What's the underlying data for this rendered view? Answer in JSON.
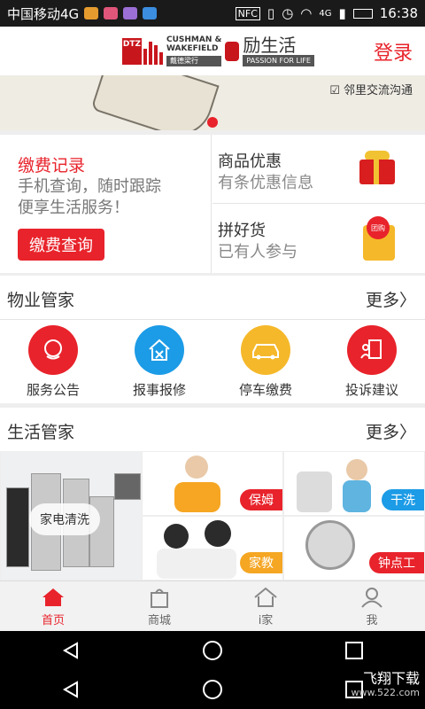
{
  "status_bar": {
    "carrier": "中国移动4G",
    "nfc": "NFC",
    "network": "4G",
    "time": "16:38"
  },
  "header": {
    "logo_dtz": "DTZ",
    "logo_line1": "CUSHMAN &",
    "logo_line2": "WAKEFIELD",
    "logo_cn": "戴德梁行",
    "brand_name": "励生活",
    "brand_slogan": "PASSION FOR LIFE",
    "login_label": "登录"
  },
  "banner": {
    "tag": "☑ 邻里交流沟通"
  },
  "promo": {
    "left_title": "缴费记录",
    "left_desc1": "手机查询，随时跟踪",
    "left_desc2": "便享生活服务！",
    "left_button": "缴费查询",
    "top_right_title": "商品优惠",
    "top_right_desc": "有条优惠信息",
    "bottom_right_title": "拼好货",
    "bottom_right_desc": "已有人参与",
    "group_badge": "团购"
  },
  "property": {
    "title": "物业管家",
    "more": "更多〉",
    "items": [
      {
        "label": "服务公告",
        "icon": "announcement-icon"
      },
      {
        "label": "报事报修",
        "icon": "repair-icon"
      },
      {
        "label": "停车缴费",
        "icon": "car-icon"
      },
      {
        "label": "投诉建议",
        "icon": "complaint-icon"
      }
    ]
  },
  "life": {
    "title": "生活管家",
    "more": "更多〉",
    "tiles": [
      {
        "label": "家电清洗"
      },
      {
        "label": "保姆"
      },
      {
        "label": "干洗"
      },
      {
        "label": "家教"
      },
      {
        "label": "钟点工"
      }
    ]
  },
  "tabbar": {
    "items": [
      {
        "label": "首页"
      },
      {
        "label": "商城"
      },
      {
        "label": "i家"
      },
      {
        "label": "我"
      }
    ]
  },
  "watermark": {
    "line1": "飞翔下载",
    "line2": "www.522.com"
  },
  "colors": {
    "accent": "#e8232b",
    "svc_blue": "#1c9be6",
    "svc_yellow": "#f5b82a"
  }
}
